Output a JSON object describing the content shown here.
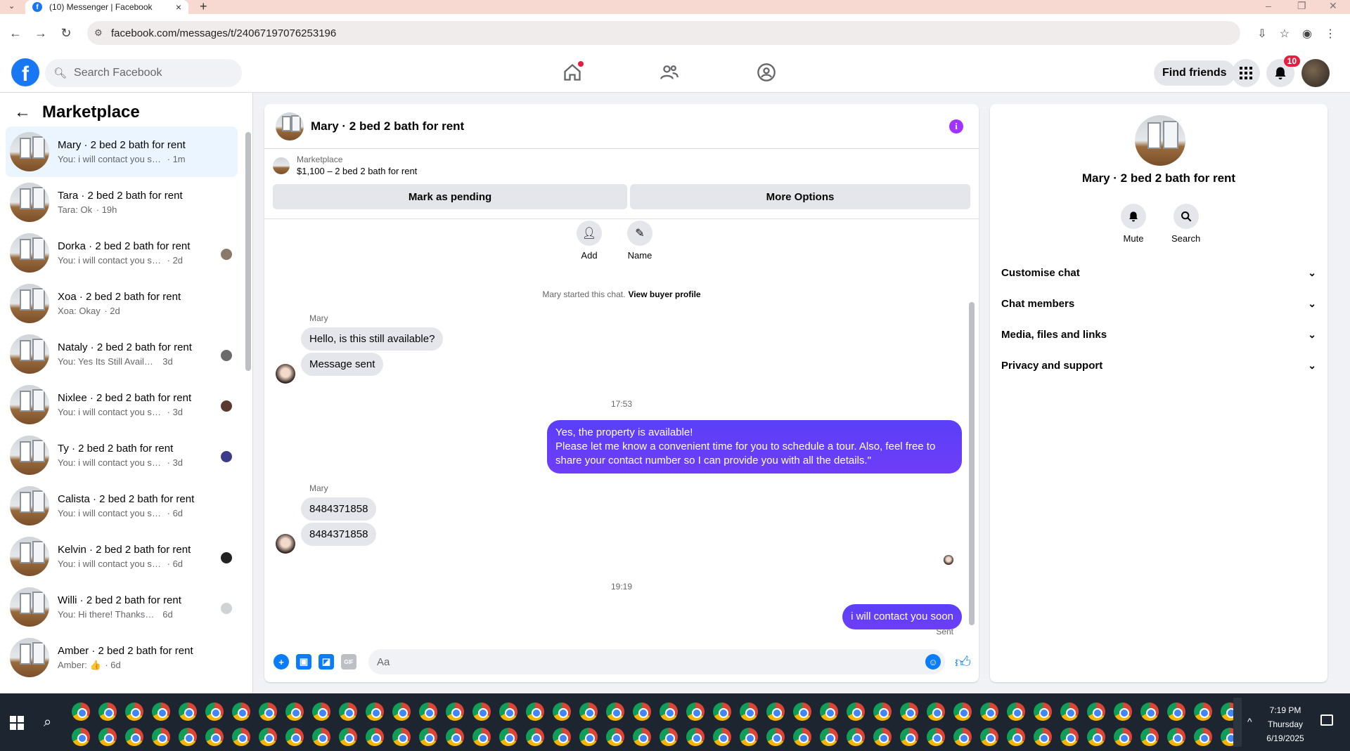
{
  "browser": {
    "tab_title": "(10) Messenger | Facebook",
    "url": "facebook.com/messages/t/24067197076253196"
  },
  "fb": {
    "search_placeholder": "Search Facebook",
    "find_friends": "Find friends",
    "notif_count": "10"
  },
  "sidebar": {
    "title": "Marketplace",
    "conversations": [
      {
        "name": "Mary · 2 bed 2 bath for rent",
        "preview": "You: i will contact you soon",
        "time": "1m",
        "active": true
      },
      {
        "name": "Tara · 2 bed 2 bath for rent",
        "preview": "Tara: Ok",
        "time": "19h"
      },
      {
        "name": "Dorka · 2 bed 2 bath for rent",
        "preview": "You: i will contact you soon",
        "time": "2d"
      },
      {
        "name": "Xoa · 2 bed 2 bath for rent",
        "preview": "Xoa: Okay",
        "time": "2d"
      },
      {
        "name": "Nataly · 2 bed 2 bath for rent",
        "preview": "You: Yes Its Still Available, Please...",
        "time": "3d"
      },
      {
        "name": "Nixlee · 2 bed 2 bath for rent",
        "preview": "You: i will contact you soon",
        "time": "3d"
      },
      {
        "name": "Ty · 2 bed 2 bath for rent",
        "preview": "You: i will contact you soon",
        "time": "3d"
      },
      {
        "name": "Calista · 2 bed 2 bath for rent",
        "preview": "You: i will contact you soon",
        "time": "6d"
      },
      {
        "name": "Kelvin · 2 bed 2 bath for rent",
        "preview": "You: i will contact you soon",
        "time": "6d"
      },
      {
        "name": "Willi · 2 bed 2 bath for rent",
        "preview": "You: Hi there! Thanks so much fo...",
        "time": "6d"
      },
      {
        "name": "Amber · 2 bed 2 bath for rent",
        "preview": "Amber: 👍",
        "time": "6d"
      }
    ]
  },
  "chat": {
    "title": "Mary · 2 bed 2 bath for rent",
    "marketplace_label": "Marketplace",
    "listing": "$1,100 – 2 bed 2 bath for rent",
    "mark_pending": "Mark as pending",
    "more_options": "More Options",
    "add_label": "Add",
    "name_label": "Name",
    "system_msg": "Mary started this chat.",
    "view_profile": "View buyer profile",
    "sender1": "Mary",
    "msg1": "Hello, is this still available?",
    "msg2": "Message sent",
    "time1": "17:53",
    "reply_line1": "Yes, the property is available!",
    "reply_line2": "Please let me know a convenient time for you to schedule a tour. Also, feel free to share your contact number so I can provide you with all the details.\"",
    "sender2": "Mary",
    "msg3": "8484371858",
    "msg4": "8484371858",
    "time2": "19:19",
    "reply2": "i will contact you soon",
    "sent_label": "Sent",
    "composer_placeholder": "Aa"
  },
  "details": {
    "name": "Mary · 2 bed 2 bath for rent",
    "mute": "Mute",
    "search": "Search",
    "sections": [
      "Customise chat",
      "Chat members",
      "Media, files and links",
      "Privacy and support"
    ]
  },
  "taskbar": {
    "time": "7:19 PM",
    "day": "Thursday",
    "date": "6/19/2025"
  },
  "colors": {
    "fb_blue": "#1877f2",
    "outgoing_bubble": "#5b3ff8",
    "info_purple": "#a033ff"
  }
}
